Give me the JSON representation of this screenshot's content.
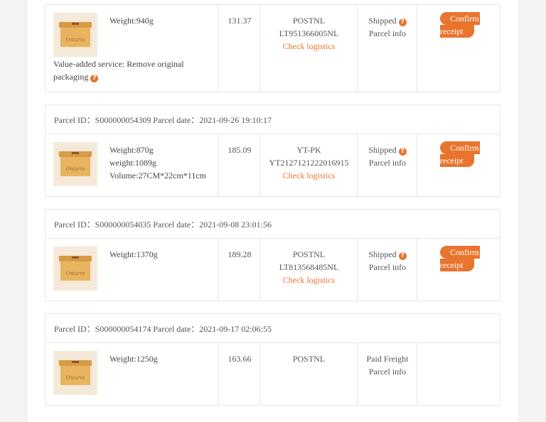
{
  "parcels": [
    {
      "id_label": "",
      "item": {
        "specs": [
          "Weight:940g"
        ],
        "extra": "Value-added service:  Remove original packaging"
      },
      "price": "131.37",
      "carrier": "POSTNL",
      "tracking": "LT951366005NL",
      "logistics_link": "Check logistics",
      "status": "Shipped",
      "status_sub": "Parcel info",
      "action": [
        "Confirm",
        "receipt"
      ]
    },
    {
      "id_label": "Parcel ID：S000000054309 Parcel date：2021-09-26 19:10:17",
      "item": {
        "specs": [
          "Weight:870g",
          "weight:1089g",
          "Volume:27CM*22cm*11cm"
        ]
      },
      "price": "185.09",
      "carrier": "YT-PK",
      "tracking": "YT2127121222016915",
      "logistics_link": "Check logistics",
      "status": "Shipped",
      "status_sub": "Parcel info",
      "action": [
        "Confirm",
        "receipt"
      ]
    },
    {
      "id_label": "Parcel ID：S000000054035 Parcel date：2021-09-08 23:01:56",
      "item": {
        "specs": [
          "Weight:1370g"
        ]
      },
      "price": "189.28",
      "carrier": "POSTNL",
      "tracking": "LT813568485NL",
      "logistics_link": "Check logistics",
      "status": "Shipped",
      "status_sub": "Parcel info",
      "action": [
        "Confirm",
        "receipt"
      ]
    },
    {
      "id_label": "Parcel ID：S000000054174 Parcel date：2021-09-17 02:06:55",
      "item": {
        "specs": [
          "Weight:1250g"
        ]
      },
      "price": "163.66",
      "carrier": "POSTNL",
      "status": "Paid Freight",
      "status_sub": "Parcel info"
    }
  ],
  "colors": {
    "accent": "#e8742e",
    "border": "#e6e6e6",
    "page_bg": "#f3f3f3"
  },
  "icons": {
    "help": "question-circle-icon",
    "thumbnail": "parcel-box-icon"
  }
}
